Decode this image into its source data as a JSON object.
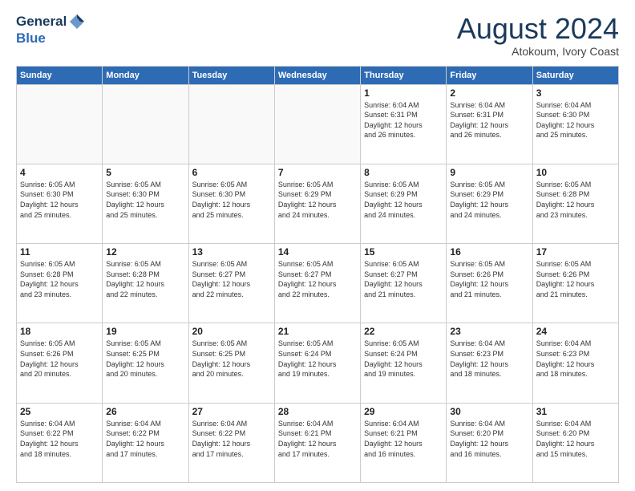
{
  "header": {
    "logo": {
      "general": "General",
      "blue": "Blue"
    },
    "title": "August 2024",
    "location": "Atokoum, Ivory Coast"
  },
  "weekdays": [
    "Sunday",
    "Monday",
    "Tuesday",
    "Wednesday",
    "Thursday",
    "Friday",
    "Saturday"
  ],
  "weeks": [
    [
      {
        "day": "",
        "text": ""
      },
      {
        "day": "",
        "text": ""
      },
      {
        "day": "",
        "text": ""
      },
      {
        "day": "",
        "text": ""
      },
      {
        "day": "1",
        "text": "Sunrise: 6:04 AM\nSunset: 6:31 PM\nDaylight: 12 hours\nand 26 minutes."
      },
      {
        "day": "2",
        "text": "Sunrise: 6:04 AM\nSunset: 6:31 PM\nDaylight: 12 hours\nand 26 minutes."
      },
      {
        "day": "3",
        "text": "Sunrise: 6:04 AM\nSunset: 6:30 PM\nDaylight: 12 hours\nand 25 minutes."
      }
    ],
    [
      {
        "day": "4",
        "text": "Sunrise: 6:05 AM\nSunset: 6:30 PM\nDaylight: 12 hours\nand 25 minutes."
      },
      {
        "day": "5",
        "text": "Sunrise: 6:05 AM\nSunset: 6:30 PM\nDaylight: 12 hours\nand 25 minutes."
      },
      {
        "day": "6",
        "text": "Sunrise: 6:05 AM\nSunset: 6:30 PM\nDaylight: 12 hours\nand 25 minutes."
      },
      {
        "day": "7",
        "text": "Sunrise: 6:05 AM\nSunset: 6:29 PM\nDaylight: 12 hours\nand 24 minutes."
      },
      {
        "day": "8",
        "text": "Sunrise: 6:05 AM\nSunset: 6:29 PM\nDaylight: 12 hours\nand 24 minutes."
      },
      {
        "day": "9",
        "text": "Sunrise: 6:05 AM\nSunset: 6:29 PM\nDaylight: 12 hours\nand 24 minutes."
      },
      {
        "day": "10",
        "text": "Sunrise: 6:05 AM\nSunset: 6:28 PM\nDaylight: 12 hours\nand 23 minutes."
      }
    ],
    [
      {
        "day": "11",
        "text": "Sunrise: 6:05 AM\nSunset: 6:28 PM\nDaylight: 12 hours\nand 23 minutes."
      },
      {
        "day": "12",
        "text": "Sunrise: 6:05 AM\nSunset: 6:28 PM\nDaylight: 12 hours\nand 22 minutes."
      },
      {
        "day": "13",
        "text": "Sunrise: 6:05 AM\nSunset: 6:27 PM\nDaylight: 12 hours\nand 22 minutes."
      },
      {
        "day": "14",
        "text": "Sunrise: 6:05 AM\nSunset: 6:27 PM\nDaylight: 12 hours\nand 22 minutes."
      },
      {
        "day": "15",
        "text": "Sunrise: 6:05 AM\nSunset: 6:27 PM\nDaylight: 12 hours\nand 21 minutes."
      },
      {
        "day": "16",
        "text": "Sunrise: 6:05 AM\nSunset: 6:26 PM\nDaylight: 12 hours\nand 21 minutes."
      },
      {
        "day": "17",
        "text": "Sunrise: 6:05 AM\nSunset: 6:26 PM\nDaylight: 12 hours\nand 21 minutes."
      }
    ],
    [
      {
        "day": "18",
        "text": "Sunrise: 6:05 AM\nSunset: 6:26 PM\nDaylight: 12 hours\nand 20 minutes."
      },
      {
        "day": "19",
        "text": "Sunrise: 6:05 AM\nSunset: 6:25 PM\nDaylight: 12 hours\nand 20 minutes."
      },
      {
        "day": "20",
        "text": "Sunrise: 6:05 AM\nSunset: 6:25 PM\nDaylight: 12 hours\nand 20 minutes."
      },
      {
        "day": "21",
        "text": "Sunrise: 6:05 AM\nSunset: 6:24 PM\nDaylight: 12 hours\nand 19 minutes."
      },
      {
        "day": "22",
        "text": "Sunrise: 6:05 AM\nSunset: 6:24 PM\nDaylight: 12 hours\nand 19 minutes."
      },
      {
        "day": "23",
        "text": "Sunrise: 6:04 AM\nSunset: 6:23 PM\nDaylight: 12 hours\nand 18 minutes."
      },
      {
        "day": "24",
        "text": "Sunrise: 6:04 AM\nSunset: 6:23 PM\nDaylight: 12 hours\nand 18 minutes."
      }
    ],
    [
      {
        "day": "25",
        "text": "Sunrise: 6:04 AM\nSunset: 6:22 PM\nDaylight: 12 hours\nand 18 minutes."
      },
      {
        "day": "26",
        "text": "Sunrise: 6:04 AM\nSunset: 6:22 PM\nDaylight: 12 hours\nand 17 minutes."
      },
      {
        "day": "27",
        "text": "Sunrise: 6:04 AM\nSunset: 6:22 PM\nDaylight: 12 hours\nand 17 minutes."
      },
      {
        "day": "28",
        "text": "Sunrise: 6:04 AM\nSunset: 6:21 PM\nDaylight: 12 hours\nand 17 minutes."
      },
      {
        "day": "29",
        "text": "Sunrise: 6:04 AM\nSunset: 6:21 PM\nDaylight: 12 hours\nand 16 minutes."
      },
      {
        "day": "30",
        "text": "Sunrise: 6:04 AM\nSunset: 6:20 PM\nDaylight: 12 hours\nand 16 minutes."
      },
      {
        "day": "31",
        "text": "Sunrise: 6:04 AM\nSunset: 6:20 PM\nDaylight: 12 hours\nand 15 minutes."
      }
    ]
  ]
}
